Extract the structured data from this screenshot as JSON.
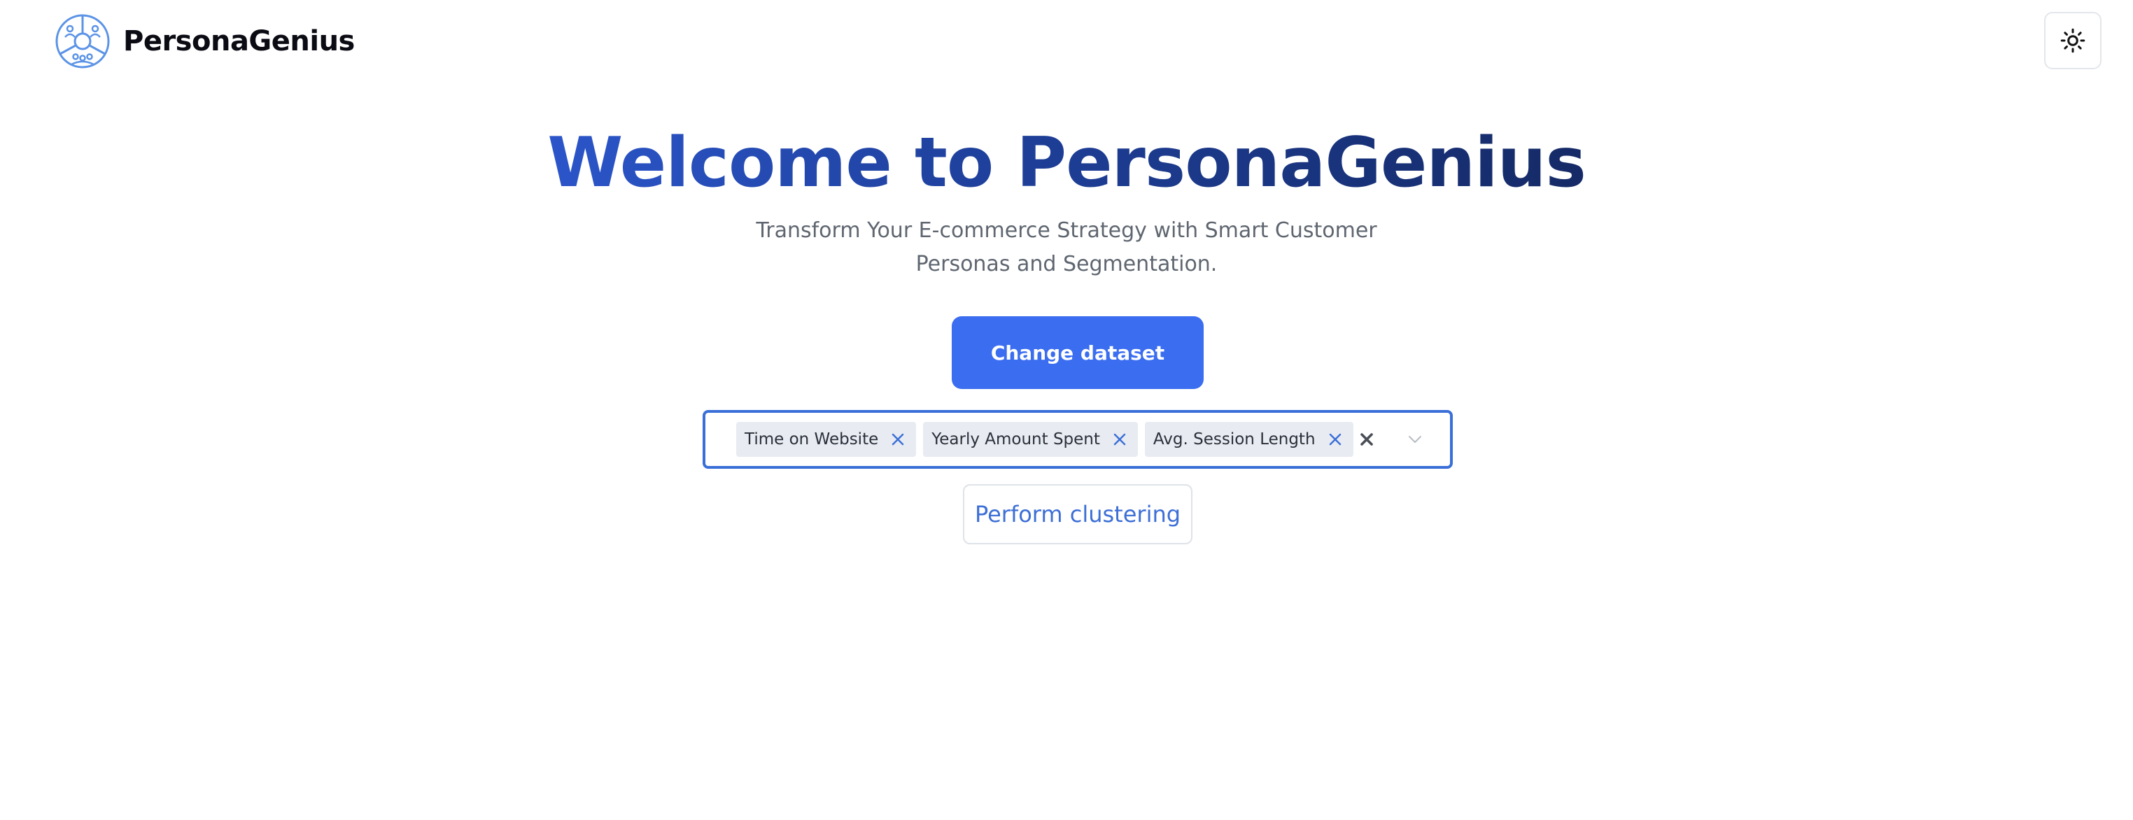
{
  "header": {
    "brand_name": "PersonaGenius",
    "logo_icon": "persona-circle-logo",
    "theme_toggle_icon": "sun-icon"
  },
  "hero": {
    "title": "Welcome to PersonaGenius",
    "subtitle": "Transform Your E-commerce Strategy with Smart Customer Personas and Segmentation."
  },
  "actions": {
    "change_dataset_label": "Change dataset",
    "perform_clustering_label": "Perform clustering"
  },
  "feature_select": {
    "selected": [
      "Time on Website",
      "Yearly Amount Spent",
      "Avg. Session Length"
    ],
    "chip_remove_icon": "close-icon",
    "clear_icon": "clear-all-icon",
    "dropdown_icon": "chevron-down-icon"
  },
  "colors": {
    "accent": "#3a6df0",
    "title_gradient_start": "#2b55c9",
    "title_gradient_end": "#152a66",
    "select_border": "#3a6fd8",
    "chip_background": "#e8ebf1",
    "secondary_text": "#3d6fd6"
  }
}
